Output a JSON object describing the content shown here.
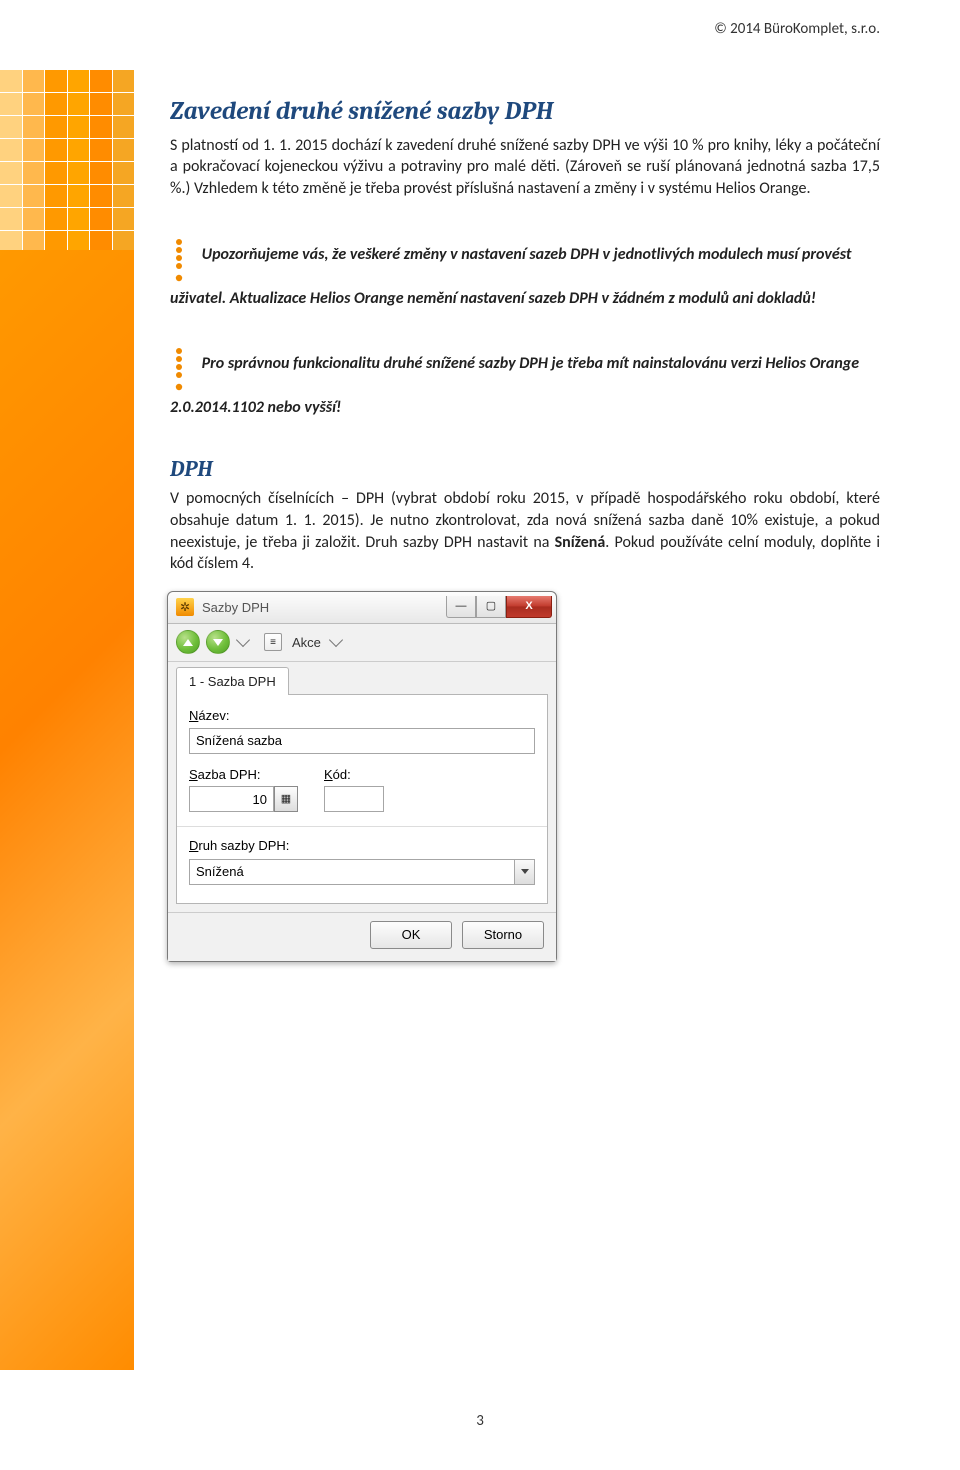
{
  "header": {
    "copyright": "© 2014 BüroKomplet, s.r.o."
  },
  "h1": "Zavedení druhé snížené sazby DPH",
  "body1": "S platností od 1. 1. 2015 dochází k zavedení druhé snížené sazby DPH ve výši 10 % pro knihy, léky a počáteční a pokračovací kojeneckou výživu a potraviny pro malé děti. (Zároveň se ruší plánovaná jednotná sazba 17,5 %.) Vzhledem k této změně je třeba provést příslušná nastavení a změny i v systému Helios Orange.",
  "note1": "Upozorňujeme vás, že veškeré změny v nastavení sazeb DPH v jednotlivých modulech musí provést uživatel. Aktualizace Helios Orange nemění nastavení sazeb DPH v žádném z modulů ani dokladů!",
  "note2": "Pro správnou funkcionalitu druhé snížené sazby DPH je třeba mít nainstalovánu verzi Helios Orange 2.0.2014.1102 nebo vyšší!",
  "h2": "DPH",
  "body2_a": "V pomocných číselnících – DPH (vybrat období roku 2015, v případě hospodářského roku období, které obsahuje datum 1. 1. 2015). Je nutno zkontrolovat, zda nová snížená sazba daně 10% existuje, a pokud neexistuje, je třeba ji založit. Druh sazby DPH nastavit na ",
  "body2_bold": "Snížená",
  "body2_b": ". Pokud používáte celní moduly, doplňte i kód číslem 4.",
  "dialog": {
    "title": "Sazby DPH",
    "akce": "Akce",
    "tab": "1 - Sazba DPH",
    "label_nazev": "Název:",
    "nazev": "Snížená sazba",
    "label_sazba": "Sazba DPH:",
    "sazba": "10",
    "label_kod": "Kód:",
    "kod": "",
    "label_druh": "Druh sazby DPH:",
    "druh": "Snížená",
    "ok": "OK",
    "storno": "Storno",
    "win": {
      "min": "—",
      "max": "▢",
      "close": "X"
    }
  },
  "pagenum": "3"
}
